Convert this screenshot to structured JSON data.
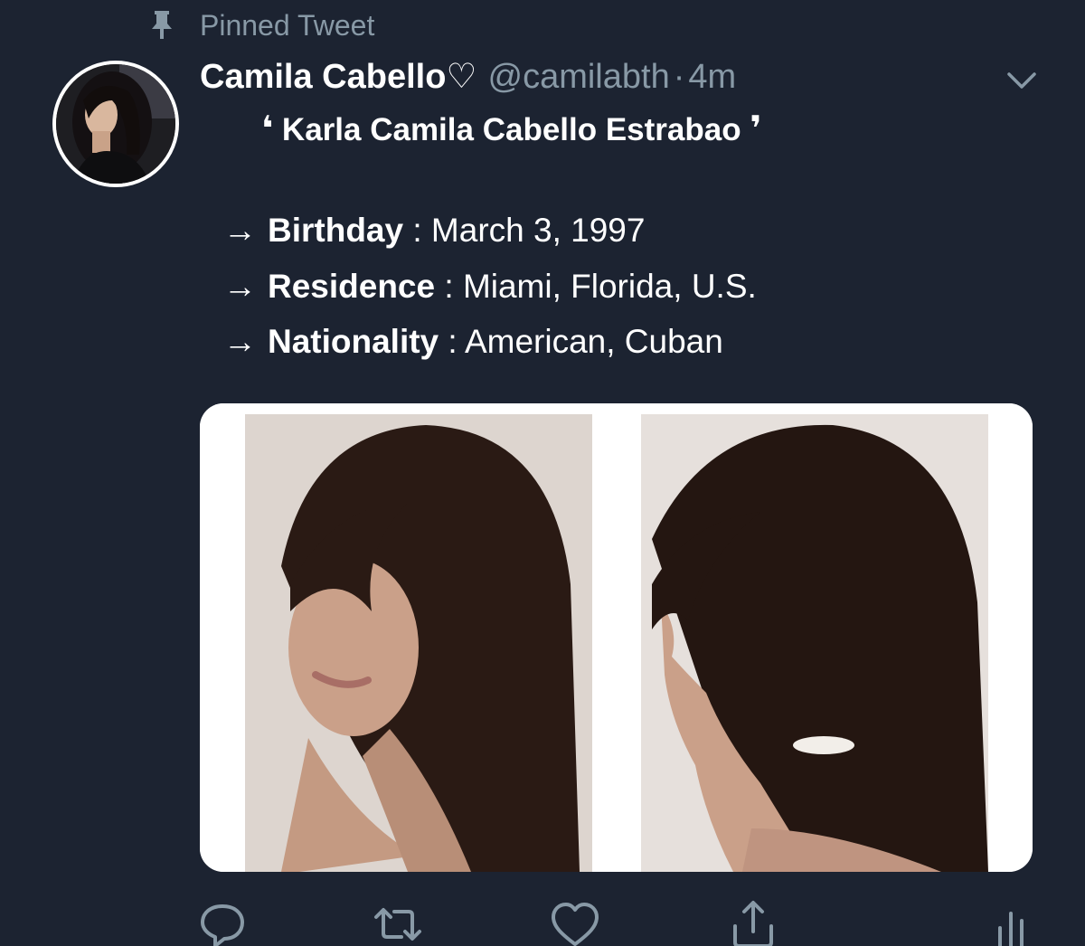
{
  "pinned": {
    "label": "Pinned Tweet",
    "icon": "pin-icon"
  },
  "author": {
    "display_name": "Camila Cabello♡",
    "handle": "@camilabth",
    "separator": "·",
    "time": "4m"
  },
  "tweet": {
    "open_quote": "❛",
    "name_line": "Karla Camila Cabello Estrabao",
    "close_quote": "❜",
    "info": [
      {
        "arrow": "→",
        "label": "Birthday",
        "sep": " : ",
        "value": "March 3, 1997"
      },
      {
        "arrow": "→",
        "label": "Residence",
        "sep": " : ",
        "value": "Miami, Florida, U.S."
      },
      {
        "arrow": "→",
        "label": "Nationality",
        "sep": " : ",
        "value": "American, Cuban"
      }
    ]
  },
  "actions": [
    {
      "name": "reply-icon"
    },
    {
      "name": "retweet-icon"
    },
    {
      "name": "like-icon"
    },
    {
      "name": "share-icon"
    },
    {
      "name": "analytics-icon"
    }
  ],
  "colors": {
    "background": "#1c2331",
    "secondary_text": "#8899a6",
    "primary_text": "#ffffff"
  }
}
